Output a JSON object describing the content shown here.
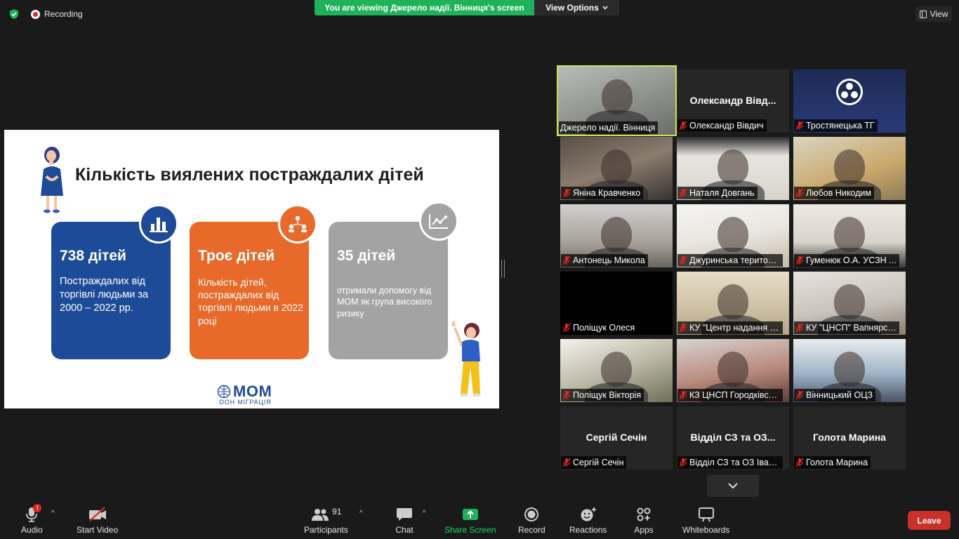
{
  "topbar": {
    "recording_label": "Recording",
    "viewing_banner": "You are viewing Джерело надії. Вінниця's screen",
    "view_options_label": "View Options",
    "view_label": "View"
  },
  "slide": {
    "title": "Кількість виялених постраждалих дітей",
    "cards": [
      {
        "big": "738 дітей",
        "text": "Постраждалих від торгівлі людьми за 2000 – 2022 рр.",
        "color": "#1e4b97"
      },
      {
        "big": "Троє дітей",
        "text": "Кількість дітей, постраждалих від торгівлі людьми в 2022 році",
        "color": "#e86a2a"
      },
      {
        "big": "35 дітей",
        "text": "отримали допомогу від МОМ як група високого ризику",
        "color": "#a3a3a3"
      }
    ],
    "logo_text": "МОМ",
    "logo_sub": "ООН МІГРАЦІЯ"
  },
  "gallery": {
    "tiles": [
      {
        "label": "Джерело надії. Вінниця",
        "bigname": "",
        "muted": false,
        "active": true
      },
      {
        "label": "Олександр Вівдич",
        "bigname": "Олександр Вівд...",
        "muted": true
      },
      {
        "label": "Тростянецька ТГ",
        "bigname": "",
        "muted": true
      },
      {
        "label": "Яніна Кравченко",
        "bigname": "",
        "muted": true
      },
      {
        "label": "Наталя Довгань",
        "bigname": "",
        "muted": true
      },
      {
        "label": "Любов Никодим",
        "bigname": "",
        "muted": true
      },
      {
        "label": "Антонець Микола",
        "bigname": "",
        "muted": true
      },
      {
        "label": "Джуринська територ...",
        "bigname": "",
        "muted": true
      },
      {
        "label": "Гуменюк О.А. УСЗН ...",
        "bigname": "",
        "muted": true
      },
      {
        "label": "Поліщук Олеся",
        "bigname": "",
        "muted": true
      },
      {
        "label": "КУ \"Центр надання с...",
        "bigname": "",
        "muted": true
      },
      {
        "label": "КУ \"ЦНСП\" Вапнярсь...",
        "bigname": "",
        "muted": true
      },
      {
        "label": "Поліщук Вікторія",
        "bigname": "",
        "muted": true
      },
      {
        "label": "КЗ ЦНСП Городківсь...",
        "bigname": "",
        "muted": true
      },
      {
        "label": "Вінницький ОЦЗ",
        "bigname": "",
        "muted": true
      },
      {
        "label": "Сергій Сечін",
        "bigname": "Сергій Сечін",
        "muted": true
      },
      {
        "label": "Відділ СЗ та ОЗ Івані...",
        "bigname": "Відділ СЗ та ОЗ...",
        "muted": true
      },
      {
        "label": "Голота Марина",
        "bigname": "Голота Марина",
        "muted": true
      }
    ]
  },
  "toolbar": {
    "audio": "Audio",
    "audio_badge": "!",
    "start_video": "Start Video",
    "participants": "Participants",
    "participants_count": "91",
    "chat": "Chat",
    "share_screen": "Share Screen",
    "record": "Record",
    "reactions": "Reactions",
    "apps": "Apps",
    "whiteboards": "Whiteboards",
    "leave": "Leave"
  },
  "colors": {
    "share_green": "#1fb25a",
    "active_speaker": "#c7e252",
    "leave_red": "#c8302a",
    "mute_red": "#e0261f"
  }
}
